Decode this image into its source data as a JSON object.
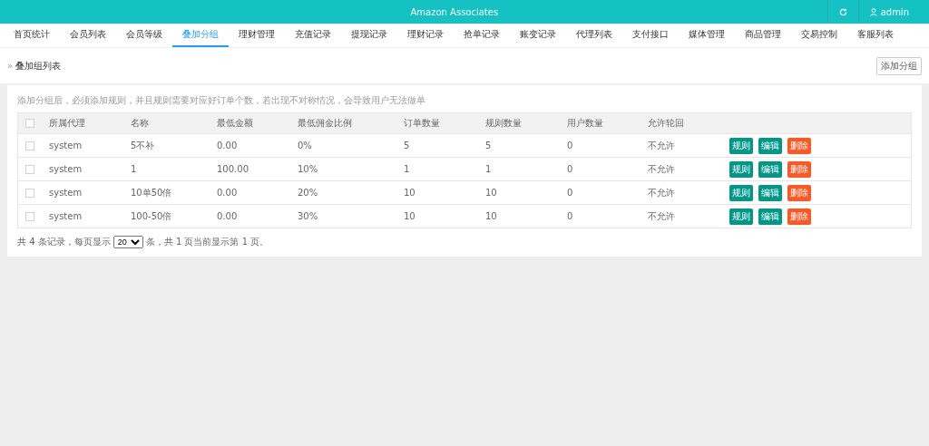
{
  "header": {
    "title": "Amazon Associates",
    "user": "admin"
  },
  "nav": [
    {
      "label": "首页统计",
      "selected": false
    },
    {
      "label": "会员列表",
      "selected": false
    },
    {
      "label": "会员等级",
      "selected": false
    },
    {
      "label": "叠加分组",
      "selected": true
    },
    {
      "label": "理财管理",
      "selected": false
    },
    {
      "label": "充值记录",
      "selected": false
    },
    {
      "label": "提现记录",
      "selected": false
    },
    {
      "label": "理财记录",
      "selected": false
    },
    {
      "label": "抢单记录",
      "selected": false
    },
    {
      "label": "账变记录",
      "selected": false
    },
    {
      "label": "代理列表",
      "selected": false
    },
    {
      "label": "支付接口",
      "selected": false
    },
    {
      "label": "媒体管理",
      "selected": false
    },
    {
      "label": "商品管理",
      "selected": false
    },
    {
      "label": "交易控制",
      "selected": false
    },
    {
      "label": "客服列表",
      "selected": false
    }
  ],
  "breadcrumb_icon": "»",
  "breadcrumb": "叠加组列表",
  "add_button": "添加分组",
  "hint": "添加分组后，必须添加规则，并且规则需要对应好订单个数，若出现不对称情况，会导致用户无法做单",
  "table": {
    "select_all_checked": false,
    "columns": [
      "所属代理",
      "名称",
      "最低金额",
      "最低佣金比例",
      "订单数量",
      "规则数量",
      "用户数量",
      "允许轮回"
    ],
    "rows": [
      {
        "checked": false,
        "cells": [
          "system",
          "5不补",
          "0.00",
          "0%",
          "5",
          "5",
          "0",
          "不允许"
        ],
        "actions": [
          "规则",
          "编辑",
          "删除"
        ]
      },
      {
        "checked": false,
        "cells": [
          "system",
          "1",
          "100.00",
          "10%",
          "1",
          "1",
          "0",
          "不允许"
        ],
        "actions": [
          "规则",
          "编辑",
          "删除"
        ]
      },
      {
        "checked": false,
        "cells": [
          "system",
          "10单50倍",
          "0.00",
          "20%",
          "10",
          "10",
          "0",
          "不允许"
        ],
        "actions": [
          "规则",
          "编辑",
          "删除"
        ]
      },
      {
        "checked": false,
        "cells": [
          "system",
          "100-50倍",
          "0.00",
          "30%",
          "10",
          "10",
          "0",
          "不允许"
        ],
        "actions": [
          "规则",
          "编辑",
          "删除"
        ]
      }
    ]
  },
  "pager": {
    "before": "共 4 条记录，每页显示",
    "page_size": "20",
    "after": "条，共 1 页当前显示第 1 页。"
  }
}
